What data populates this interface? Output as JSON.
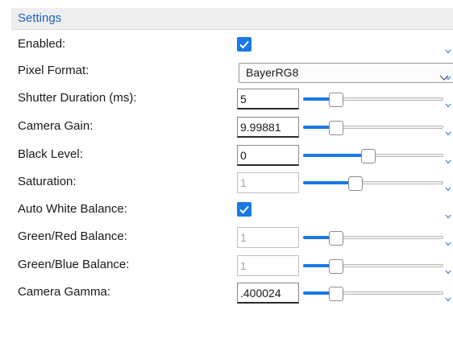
{
  "header": {
    "title": "Settings"
  },
  "rows": [
    {
      "label": "Enabled:",
      "control": "checkbox",
      "checked": true
    },
    {
      "label": "Pixel Format:",
      "control": "combo",
      "value": "BayerRG8"
    },
    {
      "label": "Shutter Duration (ms):",
      "control": "input-slider",
      "value": "5",
      "enabled": true,
      "slider_fraction": 0.12
    },
    {
      "label": "Camera Gain:",
      "control": "input-slider",
      "value": "9.99881",
      "enabled": true,
      "slider_fraction": 0.12
    },
    {
      "label": "Black Level:",
      "control": "input-slider",
      "value": "0",
      "enabled": true,
      "slider_fraction": 0.35
    },
    {
      "label": "Saturation:",
      "control": "input-slider",
      "value": "1",
      "enabled": false,
      "slider_fraction": 0.26
    },
    {
      "label": "Auto White Balance:",
      "control": "checkbox",
      "checked": true
    },
    {
      "label": "Green/Red Balance:",
      "control": "input-slider",
      "value": "1",
      "enabled": false,
      "slider_fraction": 0.12
    },
    {
      "label": "Green/Blue Balance:",
      "control": "input-slider",
      "value": "1",
      "enabled": false,
      "slider_fraction": 0.12
    },
    {
      "label": "Camera Gamma:",
      "control": "input-slider",
      "value": ".400024",
      "enabled": true,
      "slider_fraction": 0.12
    }
  ],
  "colors": {
    "accent": "#1979e6",
    "header_text": "#1a63c5",
    "header_bg": "#eeeeee"
  },
  "icons": {
    "checkbox": "checkmark-icon",
    "combo": "chevron-down-icon",
    "row_edge": "chevron-down-icon"
  }
}
